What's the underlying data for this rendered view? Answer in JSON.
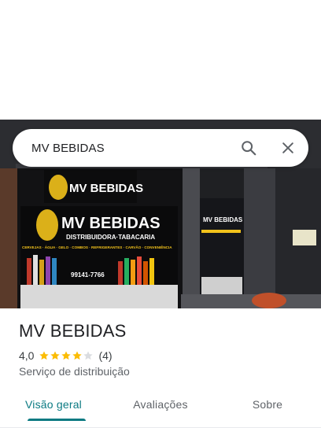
{
  "search": {
    "query": "MV BEBIDAS"
  },
  "photo": {
    "sign_main": "MV BEBIDAS",
    "sign_sub": "DISTRIBUIDORA·TABACARIA",
    "sign_items": "CERVEJAS · ÁGUA · GELO · COMBOS · REFRIGERANTES · CARVÃO · CONVENIÊNCIA",
    "sign_phone": "99141-7766",
    "colors": {
      "sign_yellow": "#f2c21b",
      "wall_dark": "#1b1c1f"
    }
  },
  "place": {
    "name": "MV BEBIDAS",
    "rating": "4,0",
    "stars_filled": 4,
    "stars_total": 5,
    "review_count": "(4)",
    "category": "Serviço de distribuição"
  },
  "tabs": [
    {
      "label": "Visão geral",
      "active": true
    },
    {
      "label": "Avaliações",
      "active": false
    },
    {
      "label": "Sobre",
      "active": false
    }
  ],
  "icons": {
    "search": "search-icon",
    "close": "close-icon",
    "star": "star-icon"
  },
  "colors": {
    "accent": "#0b7a82",
    "star": "#fbbc04",
    "star_empty": "#dadce0"
  }
}
